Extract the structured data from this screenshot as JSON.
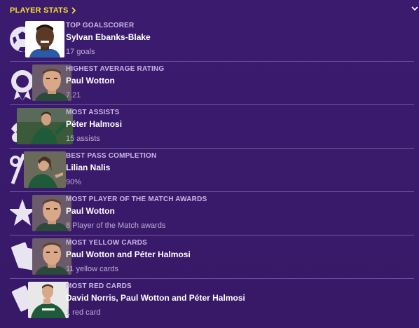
{
  "header": {
    "title": "PLAYER STATS"
  },
  "stats": [
    {
      "category": "TOP GOALSCORER",
      "player": "Sylvan Ebanks-Blake",
      "value": "17 goals",
      "icon": "football-icon"
    },
    {
      "category": "HIGHEST AVERAGE RATING",
      "player": "Paul Wotton",
      "value": "7.21",
      "icon": "rating-badge-icon"
    },
    {
      "category": "MOST ASSISTS",
      "player": "Péter Halmosi",
      "value": "15 assists",
      "icon": "assist-icon"
    },
    {
      "category": "BEST PASS COMPLETION",
      "player": "Lilian Nalis",
      "value": "90%",
      "icon": "percent-icon"
    },
    {
      "category": "MOST PLAYER OF THE MATCH AWARDS",
      "player": "Paul Wotton",
      "value": "8 Player of the Match awards",
      "icon": "star-icon"
    },
    {
      "category": "MOST YELLOW CARDS",
      "player": "Paul Wotton and Péter Halmosi",
      "value": "11 yellow cards",
      "icon": "cards-icon"
    },
    {
      "category": "MOST RED CARDS",
      "player": "David Norris, Paul Wotton and Péter Halmosi",
      "value": "1 red card",
      "icon": "card-icon"
    }
  ]
}
